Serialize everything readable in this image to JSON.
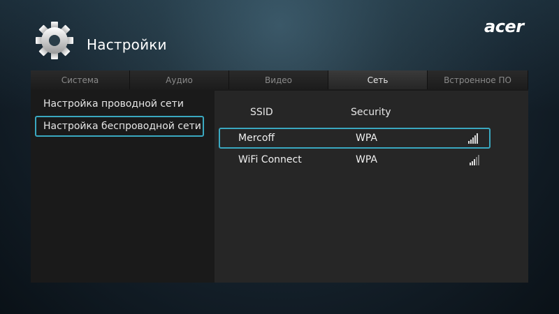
{
  "header": {
    "title": "Настройки",
    "logo": "acer",
    "icon": "gear-icon"
  },
  "tabs": [
    {
      "label": "Система",
      "active": false
    },
    {
      "label": "Аудио",
      "active": false
    },
    {
      "label": "Видео",
      "active": false
    },
    {
      "label": "Сеть",
      "active": true
    },
    {
      "label": "Встроенное ПО",
      "active": false
    }
  ],
  "left_menu": {
    "items": [
      {
        "label": "Настройка проводной сети",
        "selected": false
      },
      {
        "label": "Настройка беспроводной сети",
        "selected": true
      }
    ]
  },
  "network_list": {
    "columns": {
      "ssid": "SSID",
      "security": "Security"
    },
    "rows": [
      {
        "ssid": "Mercoff",
        "security": "WPA",
        "signal_bars": 5,
        "selected": true
      },
      {
        "ssid": "WiFi Connect",
        "security": "WPA",
        "signal_bars": 3,
        "selected": false
      }
    ]
  },
  "colors": {
    "accent": "#3aa8c0",
    "panel": "#1a1a1a",
    "pane": "#262626"
  }
}
